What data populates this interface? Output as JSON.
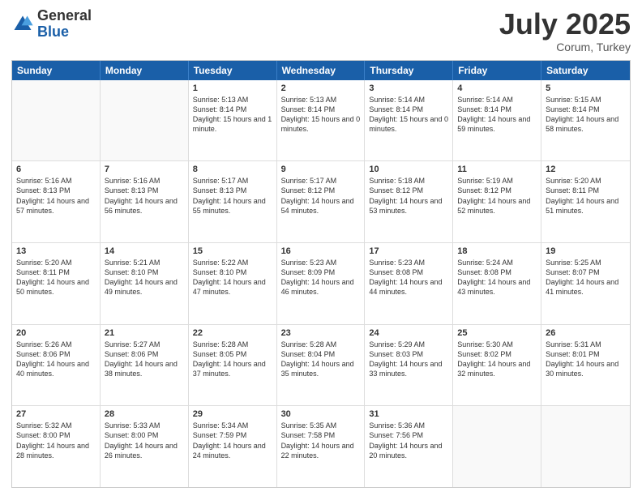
{
  "header": {
    "logo_general": "General",
    "logo_blue": "Blue",
    "month": "July 2025",
    "location": "Corum, Turkey"
  },
  "weekdays": [
    "Sunday",
    "Monday",
    "Tuesday",
    "Wednesday",
    "Thursday",
    "Friday",
    "Saturday"
  ],
  "weeks": [
    [
      {
        "day": "",
        "sunrise": "",
        "sunset": "",
        "daylight": ""
      },
      {
        "day": "",
        "sunrise": "",
        "sunset": "",
        "daylight": ""
      },
      {
        "day": "1",
        "sunrise": "Sunrise: 5:13 AM",
        "sunset": "Sunset: 8:14 PM",
        "daylight": "Daylight: 15 hours and 1 minute."
      },
      {
        "day": "2",
        "sunrise": "Sunrise: 5:13 AM",
        "sunset": "Sunset: 8:14 PM",
        "daylight": "Daylight: 15 hours and 0 minutes."
      },
      {
        "day": "3",
        "sunrise": "Sunrise: 5:14 AM",
        "sunset": "Sunset: 8:14 PM",
        "daylight": "Daylight: 15 hours and 0 minutes."
      },
      {
        "day": "4",
        "sunrise": "Sunrise: 5:14 AM",
        "sunset": "Sunset: 8:14 PM",
        "daylight": "Daylight: 14 hours and 59 minutes."
      },
      {
        "day": "5",
        "sunrise": "Sunrise: 5:15 AM",
        "sunset": "Sunset: 8:14 PM",
        "daylight": "Daylight: 14 hours and 58 minutes."
      }
    ],
    [
      {
        "day": "6",
        "sunrise": "Sunrise: 5:16 AM",
        "sunset": "Sunset: 8:13 PM",
        "daylight": "Daylight: 14 hours and 57 minutes."
      },
      {
        "day": "7",
        "sunrise": "Sunrise: 5:16 AM",
        "sunset": "Sunset: 8:13 PM",
        "daylight": "Daylight: 14 hours and 56 minutes."
      },
      {
        "day": "8",
        "sunrise": "Sunrise: 5:17 AM",
        "sunset": "Sunset: 8:13 PM",
        "daylight": "Daylight: 14 hours and 55 minutes."
      },
      {
        "day": "9",
        "sunrise": "Sunrise: 5:17 AM",
        "sunset": "Sunset: 8:12 PM",
        "daylight": "Daylight: 14 hours and 54 minutes."
      },
      {
        "day": "10",
        "sunrise": "Sunrise: 5:18 AM",
        "sunset": "Sunset: 8:12 PM",
        "daylight": "Daylight: 14 hours and 53 minutes."
      },
      {
        "day": "11",
        "sunrise": "Sunrise: 5:19 AM",
        "sunset": "Sunset: 8:12 PM",
        "daylight": "Daylight: 14 hours and 52 minutes."
      },
      {
        "day": "12",
        "sunrise": "Sunrise: 5:20 AM",
        "sunset": "Sunset: 8:11 PM",
        "daylight": "Daylight: 14 hours and 51 minutes."
      }
    ],
    [
      {
        "day": "13",
        "sunrise": "Sunrise: 5:20 AM",
        "sunset": "Sunset: 8:11 PM",
        "daylight": "Daylight: 14 hours and 50 minutes."
      },
      {
        "day": "14",
        "sunrise": "Sunrise: 5:21 AM",
        "sunset": "Sunset: 8:10 PM",
        "daylight": "Daylight: 14 hours and 49 minutes."
      },
      {
        "day": "15",
        "sunrise": "Sunrise: 5:22 AM",
        "sunset": "Sunset: 8:10 PM",
        "daylight": "Daylight: 14 hours and 47 minutes."
      },
      {
        "day": "16",
        "sunrise": "Sunrise: 5:23 AM",
        "sunset": "Sunset: 8:09 PM",
        "daylight": "Daylight: 14 hours and 46 minutes."
      },
      {
        "day": "17",
        "sunrise": "Sunrise: 5:23 AM",
        "sunset": "Sunset: 8:08 PM",
        "daylight": "Daylight: 14 hours and 44 minutes."
      },
      {
        "day": "18",
        "sunrise": "Sunrise: 5:24 AM",
        "sunset": "Sunset: 8:08 PM",
        "daylight": "Daylight: 14 hours and 43 minutes."
      },
      {
        "day": "19",
        "sunrise": "Sunrise: 5:25 AM",
        "sunset": "Sunset: 8:07 PM",
        "daylight": "Daylight: 14 hours and 41 minutes."
      }
    ],
    [
      {
        "day": "20",
        "sunrise": "Sunrise: 5:26 AM",
        "sunset": "Sunset: 8:06 PM",
        "daylight": "Daylight: 14 hours and 40 minutes."
      },
      {
        "day": "21",
        "sunrise": "Sunrise: 5:27 AM",
        "sunset": "Sunset: 8:06 PM",
        "daylight": "Daylight: 14 hours and 38 minutes."
      },
      {
        "day": "22",
        "sunrise": "Sunrise: 5:28 AM",
        "sunset": "Sunset: 8:05 PM",
        "daylight": "Daylight: 14 hours and 37 minutes."
      },
      {
        "day": "23",
        "sunrise": "Sunrise: 5:28 AM",
        "sunset": "Sunset: 8:04 PM",
        "daylight": "Daylight: 14 hours and 35 minutes."
      },
      {
        "day": "24",
        "sunrise": "Sunrise: 5:29 AM",
        "sunset": "Sunset: 8:03 PM",
        "daylight": "Daylight: 14 hours and 33 minutes."
      },
      {
        "day": "25",
        "sunrise": "Sunrise: 5:30 AM",
        "sunset": "Sunset: 8:02 PM",
        "daylight": "Daylight: 14 hours and 32 minutes."
      },
      {
        "day": "26",
        "sunrise": "Sunrise: 5:31 AM",
        "sunset": "Sunset: 8:01 PM",
        "daylight": "Daylight: 14 hours and 30 minutes."
      }
    ],
    [
      {
        "day": "27",
        "sunrise": "Sunrise: 5:32 AM",
        "sunset": "Sunset: 8:00 PM",
        "daylight": "Daylight: 14 hours and 28 minutes."
      },
      {
        "day": "28",
        "sunrise": "Sunrise: 5:33 AM",
        "sunset": "Sunset: 8:00 PM",
        "daylight": "Daylight: 14 hours and 26 minutes."
      },
      {
        "day": "29",
        "sunrise": "Sunrise: 5:34 AM",
        "sunset": "Sunset: 7:59 PM",
        "daylight": "Daylight: 14 hours and 24 minutes."
      },
      {
        "day": "30",
        "sunrise": "Sunrise: 5:35 AM",
        "sunset": "Sunset: 7:58 PM",
        "daylight": "Daylight: 14 hours and 22 minutes."
      },
      {
        "day": "31",
        "sunrise": "Sunrise: 5:36 AM",
        "sunset": "Sunset: 7:56 PM",
        "daylight": "Daylight: 14 hours and 20 minutes."
      },
      {
        "day": "",
        "sunrise": "",
        "sunset": "",
        "daylight": ""
      },
      {
        "day": "",
        "sunrise": "",
        "sunset": "",
        "daylight": ""
      }
    ]
  ]
}
